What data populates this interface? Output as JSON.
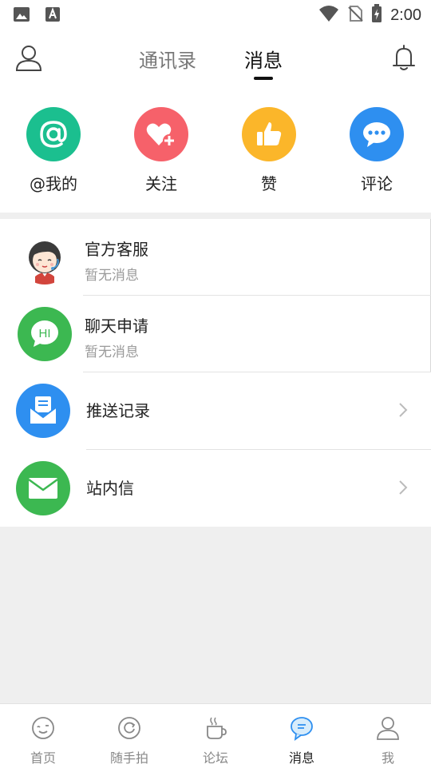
{
  "status_bar": {
    "time": "2:00"
  },
  "header": {
    "tabs": [
      {
        "label": "通讯录",
        "active": false
      },
      {
        "label": "消息",
        "active": true
      }
    ]
  },
  "quick_actions": [
    {
      "label": "@我的",
      "color": "#1bbf8f",
      "icon": "at-icon"
    },
    {
      "label": "关注",
      "color": "#f6616a",
      "icon": "heart-plus-icon"
    },
    {
      "label": "赞",
      "color": "#fbb62a",
      "icon": "thumbs-up-icon"
    },
    {
      "label": "评论",
      "color": "#2e8ff0",
      "icon": "comment-bubble-icon"
    }
  ],
  "conversations": [
    {
      "title": "官方客服",
      "subtitle": "暂无消息",
      "icon": "support-agent-avatar"
    },
    {
      "title": "聊天申请",
      "subtitle": "暂无消息",
      "icon": "hi-chat-icon",
      "avatar_text": "HI",
      "color": "#3cb851"
    }
  ],
  "entries": [
    {
      "label": "推送记录",
      "icon": "push-record-icon",
      "color": "#2e8ff0"
    },
    {
      "label": "站内信",
      "icon": "mail-icon",
      "color": "#3cb851"
    }
  ],
  "bottom_nav": [
    {
      "label": "首页",
      "icon": "home-face-icon",
      "active": false
    },
    {
      "label": "随手拍",
      "icon": "camera-refresh-icon",
      "active": false
    },
    {
      "label": "论坛",
      "icon": "coffee-cup-icon",
      "active": false
    },
    {
      "label": "消息",
      "icon": "message-bubble-icon",
      "active": true
    },
    {
      "label": "我",
      "icon": "person-icon",
      "active": false
    }
  ]
}
